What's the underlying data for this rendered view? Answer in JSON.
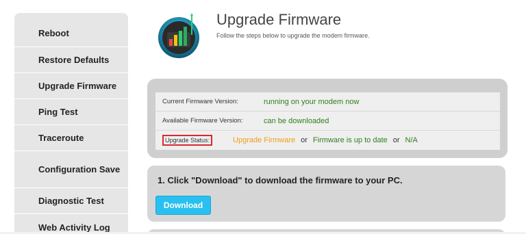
{
  "sidebar": {
    "items": [
      {
        "label": "Reboot"
      },
      {
        "label": "Restore Defaults"
      },
      {
        "label": "Upgrade Firmware"
      },
      {
        "label": "Ping Test"
      },
      {
        "label": "Traceroute"
      },
      {
        "label": "Configuration Save"
      },
      {
        "label": "Diagnostic Test"
      },
      {
        "label": "Web Activity Log"
      }
    ]
  },
  "header": {
    "icon": "firmware-upgrade-icon",
    "title": "Upgrade Firmware",
    "subtitle": "Follow the steps below to upgrade the modem firmware."
  },
  "status": {
    "current": {
      "label": "Current Firmware Version:",
      "value": "running on your modem now"
    },
    "available": {
      "label": "Available Firmware Version:",
      "value": "can be downloaded"
    },
    "upgrade": {
      "label": "Upgrade Status:",
      "option1": "Upgrade Firmware",
      "or1": "or",
      "option2": "Firmware is up to date",
      "or2": "or",
      "option3": "N/A"
    }
  },
  "step1": {
    "text": "1. Click \"Download\" to download the firmware to your PC.",
    "button_label": "Download"
  },
  "colors": {
    "accent_button": "#29c0f0",
    "status_green": "#2e7d1e",
    "status_orange": "#f39c12",
    "highlight_red": "#d9292b"
  }
}
